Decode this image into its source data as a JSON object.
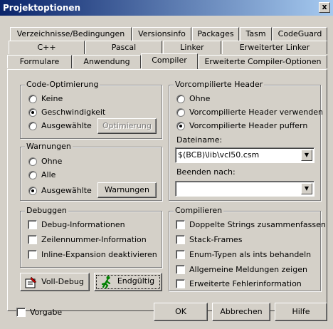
{
  "window": {
    "title": "Projektoptionen",
    "close_label": "x"
  },
  "tabs_row1": [
    "Verzeichnisse/Bedingungen",
    "Versionsinfo",
    "Packages",
    "Tasm",
    "CodeGuard"
  ],
  "tabs_row2": [
    "C++",
    "Pascal",
    "Linker",
    "Erweiterter Linker"
  ],
  "tabs_row3": [
    "Formulare",
    "Anwendung",
    "Compiler",
    "Erweiterte Compiler-Optionen"
  ],
  "code_opt": {
    "title": "Code-Optimierung",
    "options": [
      "Keine",
      "Geschwindigkeit",
      "Ausgewählte"
    ],
    "selected": 1,
    "button": "Optimierung"
  },
  "warnings": {
    "title": "Warnungen",
    "options": [
      "Ohne",
      "Alle",
      "Ausgewählte"
    ],
    "selected": 2,
    "button": "Warnungen"
  },
  "debug": {
    "title": "Debuggen",
    "items": [
      "Debug-Informationen",
      "Zeilennummer-Information",
      "Inline-Expansion deaktivieren"
    ]
  },
  "buttons": {
    "full_debug": "Voll-Debug",
    "release": "Endgültig"
  },
  "precompiled": {
    "title": "Vorcompilierte Header",
    "options": [
      "Ohne",
      "Vorcompilierte Header verwenden",
      "Vorcompilierte Header puffern"
    ],
    "selected": 2,
    "filename_label": "Dateiname:",
    "filename_value": "$(BCB)\\lib\\vcl50.csm",
    "stop_after_label": "Beenden nach:",
    "stop_after_value": ""
  },
  "compile": {
    "title": "Compilieren",
    "items": [
      "Doppelte Strings zusammenfassen",
      "Stack-Frames",
      "Enum-Typen als ints behandeln",
      "Allgemeine Meldungen zeigen",
      "Erweiterte Fehlerinformation"
    ]
  },
  "footer": {
    "default_label": "Vorgabe",
    "ok": "OK",
    "cancel": "Abbrechen",
    "help": "Hilfe"
  }
}
